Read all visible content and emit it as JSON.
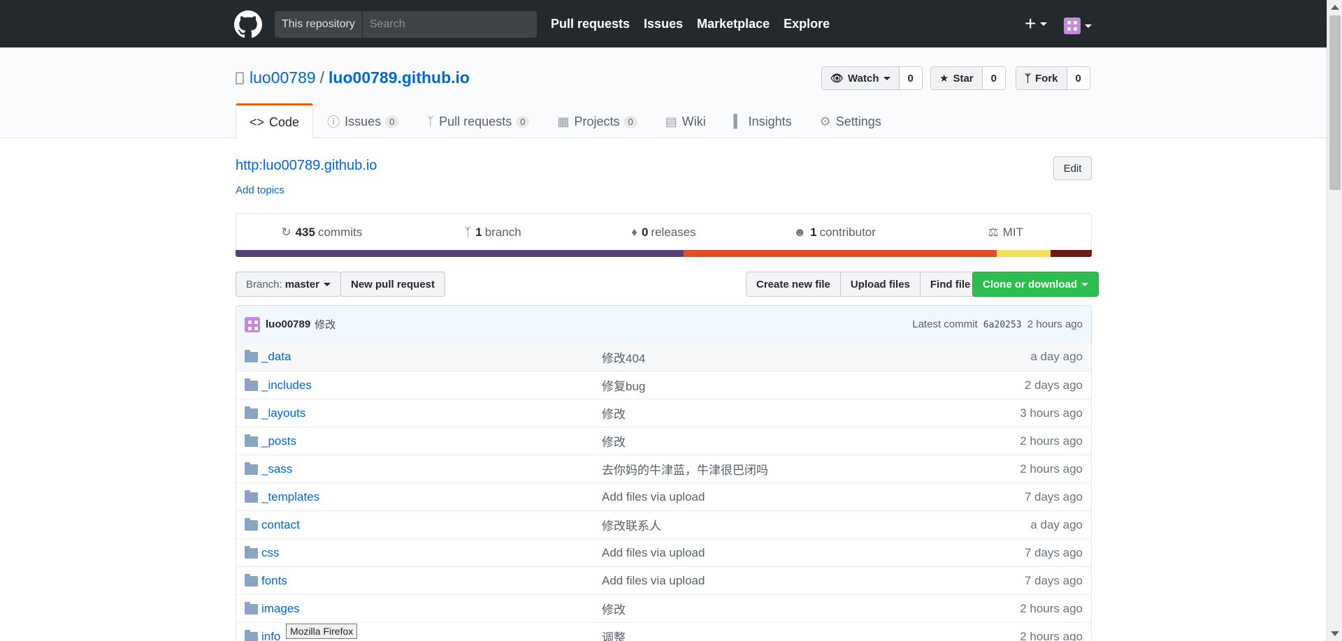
{
  "header": {
    "search_scope": "This repository",
    "search_placeholder": "Search",
    "nav": [
      "Pull requests",
      "Issues",
      "Marketplace",
      "Explore"
    ],
    "plus": "+"
  },
  "repo": {
    "owner": "luo00789",
    "separator": "/",
    "name": "luo00789.github.io",
    "watch_label": "Watch",
    "watch_count": "0",
    "star_label": "Star",
    "star_count": "0",
    "fork_label": "Fork",
    "fork_count": "0"
  },
  "tabs": [
    {
      "label": "Code",
      "icon": "code-icon"
    },
    {
      "label": "Issues",
      "count": "0",
      "icon": "issue-icon"
    },
    {
      "label": "Pull requests",
      "count": "0",
      "icon": "pull-request-icon"
    },
    {
      "label": "Projects",
      "count": "0",
      "icon": "project-icon"
    },
    {
      "label": "Wiki",
      "icon": "book-icon"
    },
    {
      "label": "Insights",
      "icon": "graph-icon"
    },
    {
      "label": "Settings",
      "icon": "gear-icon"
    }
  ],
  "about": {
    "homepage": "http:luo00789.github.io",
    "add_topics": "Add topics",
    "edit": "Edit"
  },
  "summary": {
    "commits_count": "435",
    "commits_label": "commits",
    "branch_count": "1",
    "branch_label": "branch",
    "releases_count": "0",
    "releases_label": "releases",
    "contributors_count": "1",
    "contributors_label": "contributor",
    "license": "MIT"
  },
  "language_bar": [
    {
      "color": "#563d7c",
      "share": 0.523
    },
    {
      "color": "#e34c26",
      "share": 0.366
    },
    {
      "color": "#f1e05a",
      "share": 0.063
    },
    {
      "color": "#701516",
      "share": 0.048
    }
  ],
  "file_nav": {
    "branch_prefix": "Branch:",
    "branch_name": "master",
    "new_pull_request": "New pull request",
    "create_new_file": "Create new file",
    "upload_files": "Upload files",
    "find_file": "Find file",
    "clone_or_download": "Clone or download"
  },
  "latest_commit": {
    "author": "luo00789",
    "message": "修改",
    "prefix": "Latest commit",
    "sha": "6a20253",
    "age": "2 hours ago"
  },
  "files": [
    {
      "name": "_data",
      "message": "修改404",
      "age": "a day ago"
    },
    {
      "name": "_includes",
      "message": "修复bug",
      "age": "2 days ago"
    },
    {
      "name": "_layouts",
      "message": "修改",
      "age": "3 hours ago"
    },
    {
      "name": "_posts",
      "message": "修改",
      "age": "2 hours ago"
    },
    {
      "name": "_sass",
      "message": "去你妈的牛津蓝，牛津很巴闭吗",
      "age": "2 hours ago"
    },
    {
      "name": "_templates",
      "message": "Add files via upload",
      "age": "7 days ago"
    },
    {
      "name": "contact",
      "message": "修改联系人",
      "age": "a day ago"
    },
    {
      "name": "css",
      "message": "Add files via upload",
      "age": "7 days ago"
    },
    {
      "name": "fonts",
      "message": "Add files via upload",
      "age": "7 days ago"
    },
    {
      "name": "images",
      "message": "修改",
      "age": "2 hours ago"
    },
    {
      "name": "info",
      "message": "调整",
      "age": "2 hours ago"
    }
  ],
  "tooltip": "Mozilla Firefox"
}
